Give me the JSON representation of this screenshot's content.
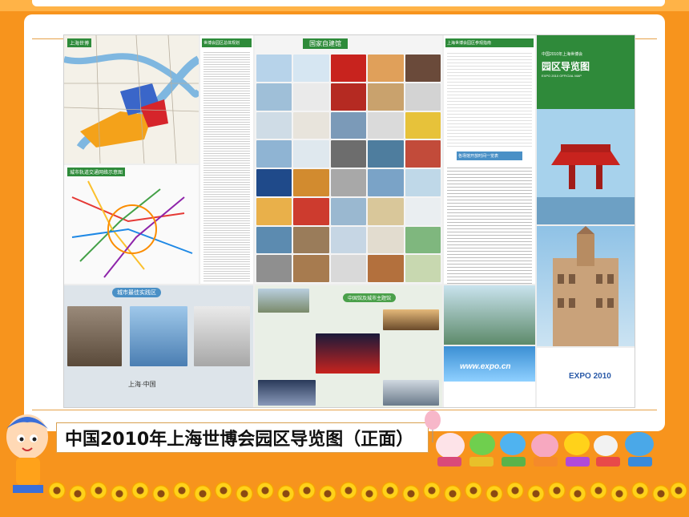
{
  "slide": {
    "caption": "中国2010年上海世博会园区导览图（正面）"
  },
  "map_sheet": {
    "panel_titles": {
      "shanghai_map": "上海世博",
      "metro": "城市轨道交通网络示意图",
      "expo_info": "世博会园区总体规划",
      "national_pavilions": "国家自建馆",
      "info_panel": "上海世博会园区参观指南",
      "table": "各场馆开放时间一览表",
      "cover_title": "园区导览图",
      "cover_subtitle": "中国2010年上海世博会",
      "cover_tagline": "EXPO 2010 OFFICIAL MAP",
      "urban_panel": "城市最佳实践区",
      "china_pavilion_panel": "中国馆及城市主题馆",
      "website": "www.expo.cn",
      "cover_logo": "EXPO 2010",
      "city_line": "上海·中国"
    }
  },
  "colors": {
    "background": "#f7941d",
    "card": "#ffffff",
    "china_red": "#c8231e",
    "green_header": "#2e8b3a",
    "sky_blue": "#6fb7e3"
  },
  "icons": [
    "cartoon-kid-icon",
    "cartoon-animals-icon",
    "sunflower-border-icon",
    "balloon-icon"
  ]
}
